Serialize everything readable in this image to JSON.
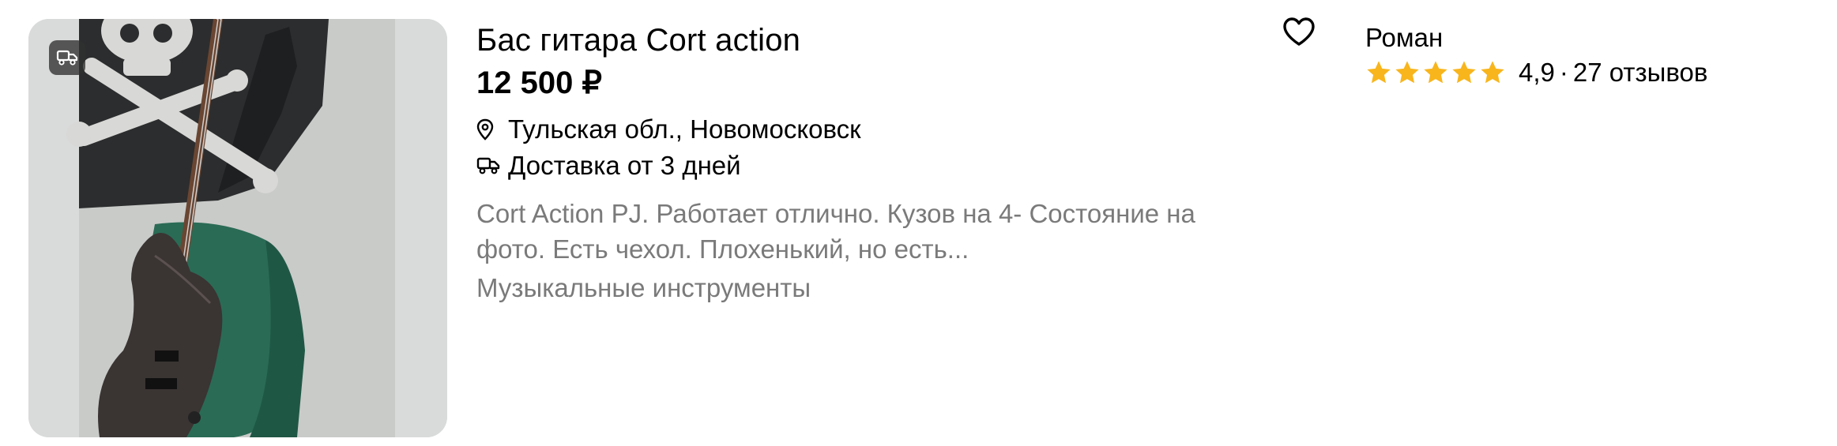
{
  "listing": {
    "title": "Бас гитара Cort action",
    "price": "12 500 ₽",
    "location": "Тульская обл., Новомосковск",
    "delivery": "Доставка от 3 дней",
    "description": "Cort Action PJ. Работает отлично. Кузов на 4- Состояние на фото. Есть чехол. Плохенький, но есть...",
    "category": "Музыкальные инструменты",
    "photo_badge_icon": "delivery-truck-icon",
    "location_icon": "location-pin-icon",
    "delivery_icon": "delivery-truck-icon",
    "favorite_icon": "heart-outline-icon"
  },
  "seller": {
    "name": "Роман",
    "rating_value": "4,9",
    "separator": "·",
    "reviews": "27 отзывов",
    "stars": 4.9,
    "stars_max": 5,
    "star_icon": "star-icon"
  },
  "colors": {
    "star": "#f8b51c",
    "text": "#000000",
    "muted_text": "#7a7a7a",
    "badge_bg": "#303030"
  }
}
